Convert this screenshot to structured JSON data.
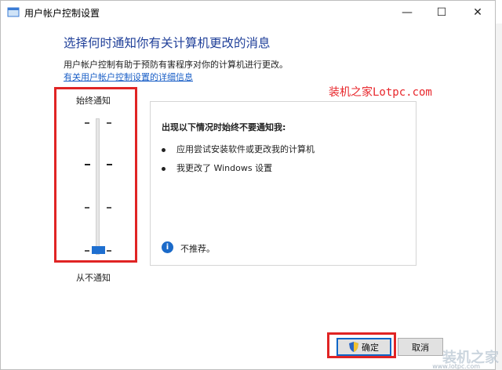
{
  "window": {
    "title": "用户帐户控制设置",
    "controls": {
      "minimize": "—",
      "maximize": "☐",
      "close": "✕"
    }
  },
  "heading": "选择何时通知你有关计算机更改的消息",
  "description": "用户帐户控制有助于预防有害程序对你的计算机进行更改。",
  "link": "有关用户帐户控制设置的详细信息",
  "watermark_red": "装机之家Lotpc.com",
  "slider": {
    "top_label": "始终通知",
    "bottom_label": "从不通知",
    "levels": 4,
    "selected_level": 1
  },
  "info": {
    "title": "出现以下情况时始终不要通知我:",
    "bullets": [
      "应用尝试安装软件或更改我的计算机",
      "我更改了 Windows 设置"
    ],
    "recommendation": "不推荐。"
  },
  "buttons": {
    "ok": "确定",
    "cancel": "取消"
  },
  "watermark_bottom": {
    "main": "装机之家",
    "sub": "www.lotpc.com"
  }
}
